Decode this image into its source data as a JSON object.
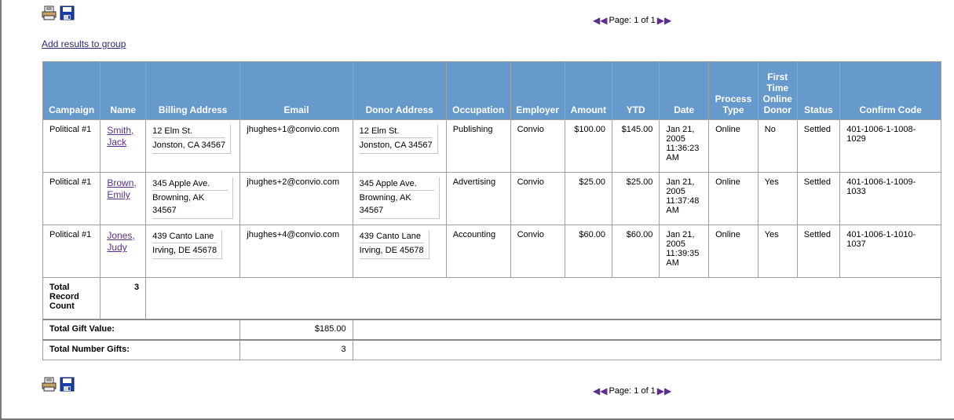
{
  "toolbar": {
    "print_icon": "printer-icon",
    "save_icon": "floppy-disk-icon"
  },
  "pager": {
    "label": "Page: 1 of 1"
  },
  "add_link": "Add results to group",
  "columns": [
    "Campaign",
    "Name",
    "Billing Address",
    "Email",
    "Donor Address",
    "Occupation",
    "Employer",
    "Amount",
    "YTD",
    "Date",
    "Process Type",
    "First Time Online Donor",
    "Status",
    "Confirm Code"
  ],
  "rows": [
    {
      "campaign": "Political #1",
      "name_last": "Smith,",
      "name_first": "Jack",
      "billing_l1": "12 Elm St.",
      "billing_l2": "Jonston, CA 34567",
      "email": "jhughes+1@convio.com",
      "donor_l1": "12 Elm St.",
      "donor_l2": "Jonston, CA 34567",
      "occupation": "Publishing",
      "employer": "Convio",
      "amount": "$100.00",
      "ytd": "$145.00",
      "date": "Jan 21, 2005 11:36:23 AM",
      "process_type": "Online",
      "first_time": "No",
      "status": "Settled",
      "confirm": "401-1006-1-1008-1029"
    },
    {
      "campaign": "Political #1",
      "name_last": "Brown,",
      "name_first": "Emily",
      "billing_l1": "345 Apple Ave.",
      "billing_l2": "Browning, AK 34567",
      "email": "jhughes+2@convio.com",
      "donor_l1": "345 Apple Ave.",
      "donor_l2": "Browning, AK 34567",
      "occupation": "Advertising",
      "employer": "Convio",
      "amount": "$25.00",
      "ytd": "$25.00",
      "date": "Jan 21, 2005 11:37:48 AM",
      "process_type": "Online",
      "first_time": "Yes",
      "status": "Settled",
      "confirm": "401-1006-1-1009-1033"
    },
    {
      "campaign": "Political #1",
      "name_last": "Jones,",
      "name_first": "Judy",
      "billing_l1": "439 Canto Lane",
      "billing_l2": "Irving, DE 45678",
      "email": "jhughes+4@convio.com",
      "donor_l1": "439 Canto Lane",
      "donor_l2": "Irving, DE 45678",
      "occupation": "Accounting",
      "employer": "Convio",
      "amount": "$60.00",
      "ytd": "$60.00",
      "date": "Jan 21, 2005 11:39:35 AM",
      "process_type": "Online",
      "first_time": "Yes",
      "status": "Settled",
      "confirm": "401-1006-1-1010-1037"
    }
  ],
  "totals": {
    "record_count_label": "Total Record Count",
    "record_count": "3",
    "gift_value_label": "Total Gift Value:",
    "gift_value": "$185.00",
    "number_gifts_label": "Total Number Gifts:",
    "number_gifts": "3"
  },
  "colors": {
    "header_bg": "#6699cc",
    "link": "#5a2e8c",
    "pager_arrow": "#5a2e8c"
  }
}
